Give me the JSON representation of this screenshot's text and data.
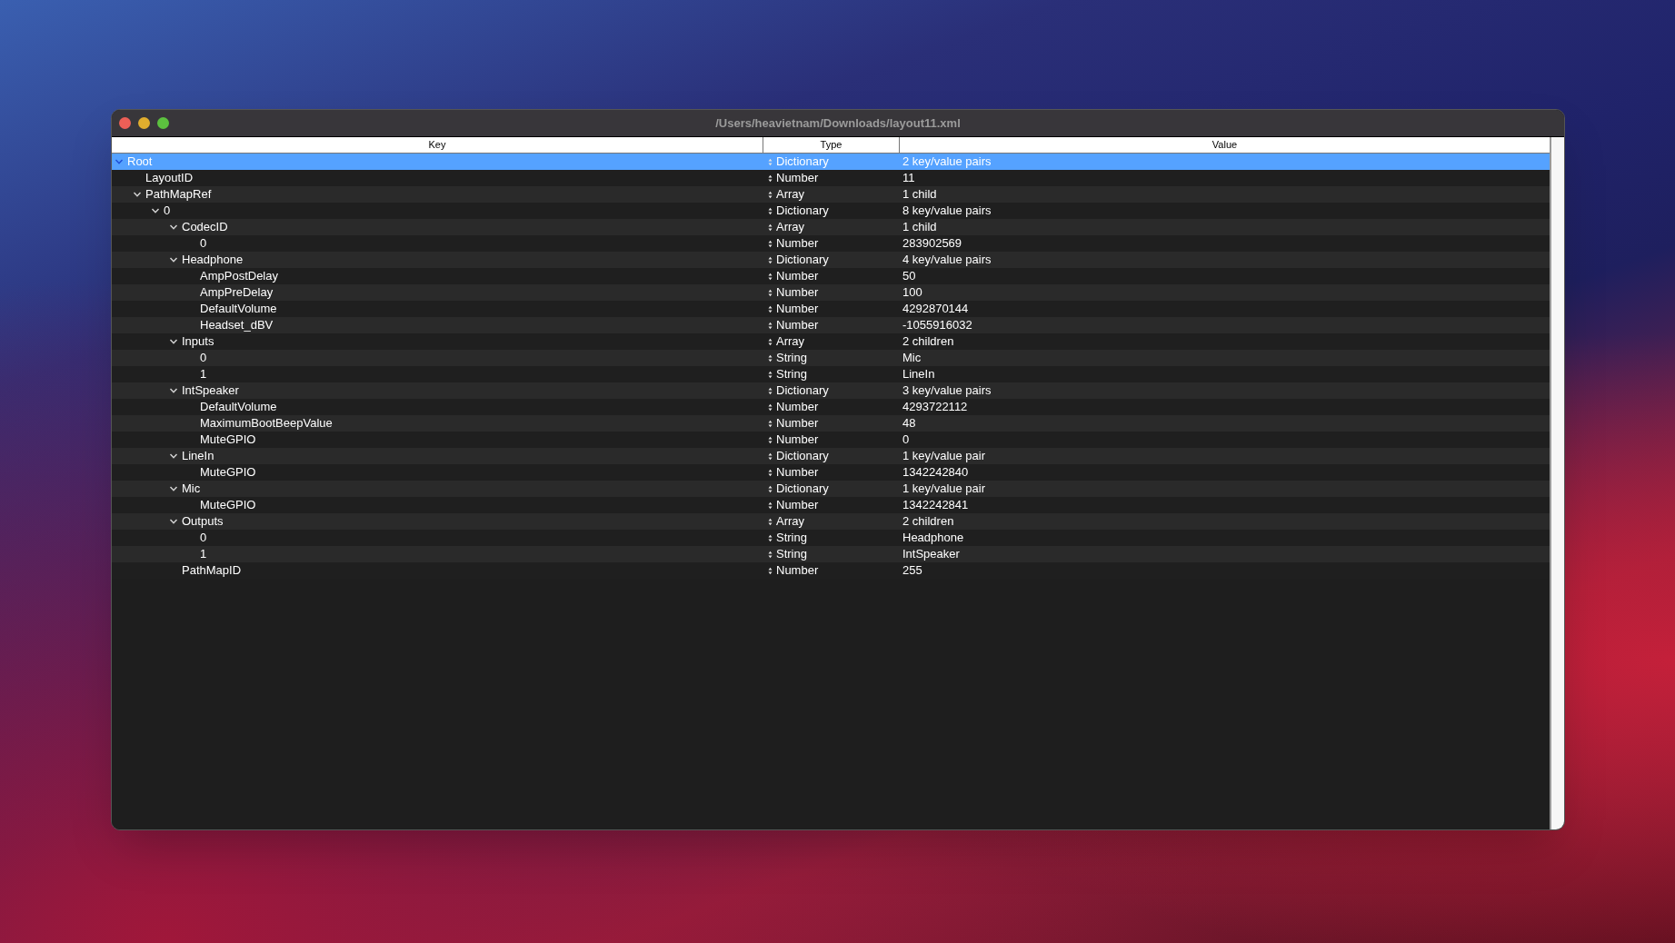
{
  "window": {
    "title": "/Users/heavietnam/Downloads/layout11.xml"
  },
  "columns": [
    "Key",
    "Type",
    "Value"
  ],
  "tree": [
    {
      "key": "Root",
      "type": "Dictionary",
      "value": "2 key/value pairs",
      "selected": true,
      "expanded": true,
      "children": [
        {
          "key": "LayoutID",
          "type": "Number",
          "value": "11",
          "selected": false
        },
        {
          "key": "PathMapRef",
          "type": "Array",
          "value": "1 child",
          "selected": false,
          "expanded": true,
          "children": [
            {
              "key": "0",
              "type": "Dictionary",
              "value": "8 key/value pairs",
              "selected": false,
              "expanded": true,
              "children": [
                {
                  "key": "CodecID",
                  "type": "Array",
                  "value": "1 child",
                  "selected": false,
                  "expanded": true,
                  "children": [
                    {
                      "key": "0",
                      "type": "Number",
                      "value": "283902569",
                      "selected": false
                    }
                  ]
                },
                {
                  "key": "Headphone",
                  "type": "Dictionary",
                  "value": "4 key/value pairs",
                  "selected": false,
                  "expanded": true,
                  "children": [
                    {
                      "key": "AmpPostDelay",
                      "type": "Number",
                      "value": "50",
                      "selected": false
                    },
                    {
                      "key": "AmpPreDelay",
                      "type": "Number",
                      "value": "100",
                      "selected": false
                    },
                    {
                      "key": "DefaultVolume",
                      "type": "Number",
                      "value": "4292870144",
                      "selected": false
                    },
                    {
                      "key": "Headset_dBV",
                      "type": "Number",
                      "value": "-1055916032",
                      "selected": false
                    }
                  ]
                },
                {
                  "key": "Inputs",
                  "type": "Array",
                  "value": "2 children",
                  "selected": false,
                  "expanded": true,
                  "children": [
                    {
                      "key": "0",
                      "type": "String",
                      "value": "Mic",
                      "selected": false
                    },
                    {
                      "key": "1",
                      "type": "String",
                      "value": "LineIn",
                      "selected": false
                    }
                  ]
                },
                {
                  "key": "IntSpeaker",
                  "type": "Dictionary",
                  "value": "3 key/value pairs",
                  "selected": false,
                  "expanded": true,
                  "children": [
                    {
                      "key": "DefaultVolume",
                      "type": "Number",
                      "value": "4293722112",
                      "selected": false
                    },
                    {
                      "key": "MaximumBootBeepValue",
                      "type": "Number",
                      "value": "48",
                      "selected": false
                    },
                    {
                      "key": "MuteGPIO",
                      "type": "Number",
                      "value": "0",
                      "selected": false
                    }
                  ]
                },
                {
                  "key": "LineIn",
                  "type": "Dictionary",
                  "value": "1 key/value pair",
                  "selected": false,
                  "expanded": true,
                  "children": [
                    {
                      "key": "MuteGPIO",
                      "type": "Number",
                      "value": "1342242840",
                      "selected": false
                    }
                  ]
                },
                {
                  "key": "Mic",
                  "type": "Dictionary",
                  "value": "1 key/value pair",
                  "selected": false,
                  "expanded": true,
                  "children": [
                    {
                      "key": "MuteGPIO",
                      "type": "Number",
                      "value": "1342242841",
                      "selected": false
                    }
                  ]
                },
                {
                  "key": "Outputs",
                  "type": "Array",
                  "value": "2 children",
                  "selected": false,
                  "expanded": true,
                  "children": [
                    {
                      "key": "0",
                      "type": "String",
                      "value": "Headphone",
                      "selected": false
                    },
                    {
                      "key": "1",
                      "type": "String",
                      "value": "IntSpeaker",
                      "selected": false
                    }
                  ]
                },
                {
                  "key": "PathMapID",
                  "type": "Number",
                  "value": "255",
                  "selected": false
                }
              ]
            }
          ]
        }
      ]
    }
  ]
}
